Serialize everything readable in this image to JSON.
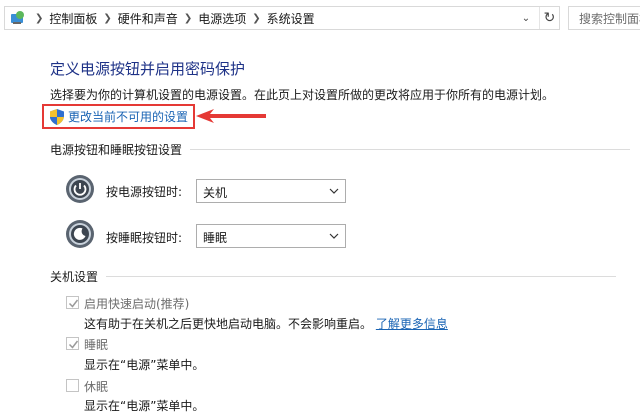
{
  "address_bar": {
    "breadcrumbs": [
      "控制面板",
      "硬件和声音",
      "电源选项",
      "系统设置"
    ],
    "search_placeholder": "搜索控制面板"
  },
  "page": {
    "title": "定义电源按钮并启用密码保护",
    "description": "选择要为你的计算机设置的电源设置。在此页上对设置所做的更改将应用于你所有的电源计划。",
    "change_link": "更改当前不可用的设置"
  },
  "power_section": {
    "heading": "电源按钮和睡眠按钮设置",
    "power_label": "按电源按钮时:",
    "power_value": "关机",
    "sleep_label": "按睡眠按钮时:",
    "sleep_value": "睡眠"
  },
  "shutdown_section": {
    "heading": "关机设置",
    "fast_startup": {
      "label": "启用快速启动(推荐)",
      "checked": true,
      "desc": "这有助于在关机之后更快地启动电脑。不会影响重启。",
      "link": "了解更多信息"
    },
    "sleep": {
      "label": "睡眠",
      "checked": true,
      "desc": "显示在“电源”菜单中。"
    },
    "hibernate": {
      "label": "休眠",
      "checked": false,
      "desc": "显示在“电源”菜单中。"
    }
  },
  "colors": {
    "title": "#1e3287",
    "link": "#1a64b4",
    "highlight": "#e53935"
  }
}
